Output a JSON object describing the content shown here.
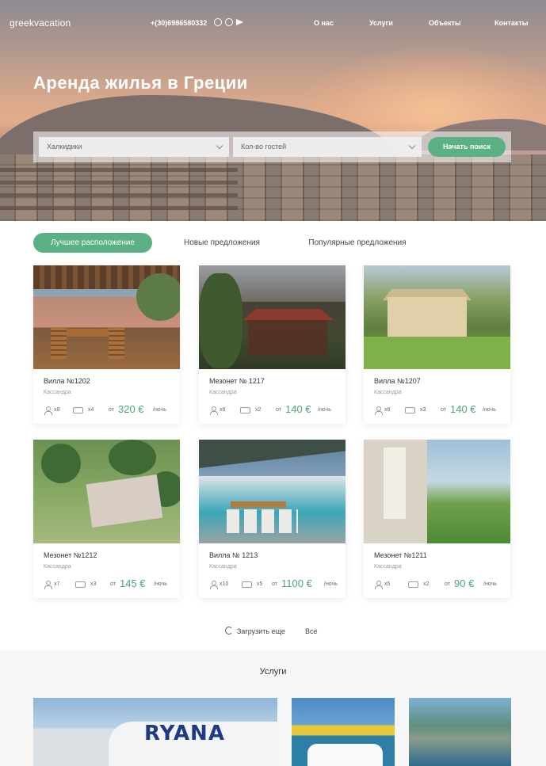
{
  "header": {
    "logo": "greekvacation",
    "phone": "+(30)6986580332",
    "social": [
      "whatsapp-icon",
      "viber-icon",
      "telegram-icon"
    ],
    "nav": [
      "О нас",
      "Услуги",
      "Объекты",
      "Контакты"
    ]
  },
  "hero": {
    "title": "Аренда жилья в Греции"
  },
  "search": {
    "region": "Халкидики",
    "guests": "Кол-во гостей",
    "button": "Начать поиск"
  },
  "tabs": [
    "Лучшее расположение",
    "Новые предложения",
    "Популярные предложения"
  ],
  "listings": [
    {
      "title": "Вилла №1202",
      "city": "Кассандра",
      "guests": "x8",
      "beds": "x4",
      "from": "от",
      "price": "320 €",
      "per": "/ночь"
    },
    {
      "title": "Мезонет № 1217",
      "city": "Кассандра",
      "guests": "x6",
      "beds": "x2",
      "from": "от",
      "price": "140 €",
      "per": "/ночь"
    },
    {
      "title": "Вилла №1207",
      "city": "Кассандра",
      "guests": "x6",
      "beds": "x3",
      "from": "от",
      "price": "140 €",
      "per": "/ночь"
    },
    {
      "title": "Мезонет №1212",
      "city": "Кассандра",
      "guests": "x7",
      "beds": "x3",
      "from": "от",
      "price": "145 €",
      "per": "/ночь"
    },
    {
      "title": "Вилла № 1213",
      "city": "Кассандра",
      "guests": "x10",
      "beds": "x5",
      "from": "от",
      "price": "1100 €",
      "per": "/ночь"
    },
    {
      "title": "Мезонет №1211",
      "city": "Кассандра",
      "guests": "x5",
      "beds": "x2",
      "from": "от",
      "price": "90 €",
      "per": "/ночь"
    }
  ],
  "load_more": "Загрузить еще",
  "all_link": "Все",
  "services": {
    "title": "Услуги",
    "airline_text": "RYANA"
  },
  "colors": {
    "accent": "#5bb184",
    "price": "#4aa676"
  }
}
